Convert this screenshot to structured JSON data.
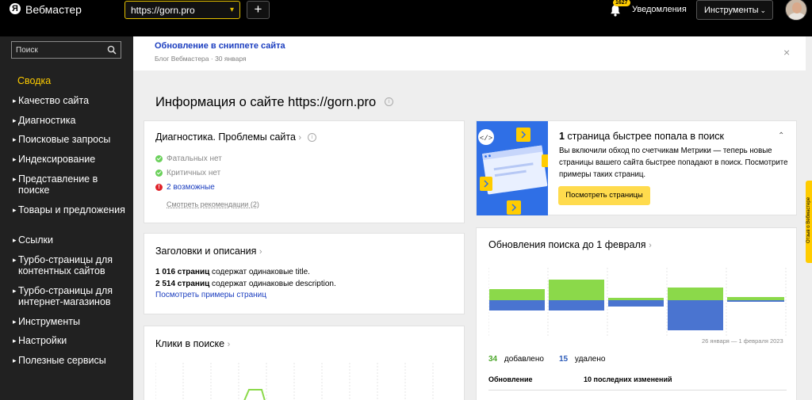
{
  "topbar": {
    "logo_letter": "Я",
    "brand": "Вебмастер",
    "site_selector": "https://gorn.pro",
    "add_site": "+",
    "notifications_count": "1627",
    "notifications_label": "Уведомления",
    "tools_label": "Инструменты"
  },
  "sidebar": {
    "search_placeholder": "Поиск",
    "items": [
      {
        "label": "Сводка",
        "active": true
      },
      {
        "label": "Качество сайта"
      },
      {
        "label": "Диагностика"
      },
      {
        "label": "Поисковые запросы"
      },
      {
        "label": "Индексирование"
      },
      {
        "label": "Представление в поиске"
      },
      {
        "label": "Товары и предложения"
      },
      {
        "label": "Ссылки"
      },
      {
        "label": "Турбо-страницы для контентных сайтов"
      },
      {
        "label": "Турбо-страницы для интернет-магазинов"
      },
      {
        "label": "Инструменты"
      },
      {
        "label": "Настройки"
      },
      {
        "label": "Полезные сервисы"
      }
    ]
  },
  "banner": {
    "title": "Обновление в сниппете сайта",
    "subtitle": "Блог Вебмастера · 30 января",
    "close": "×"
  },
  "page_title": "Информация о сайте https://gorn.pro",
  "diagnostics": {
    "title": "Диагностика. Проблемы сайта",
    "fatal": "Фатальных нет",
    "critical": "Критичных нет",
    "possible": "2 возможные",
    "more_link": "Смотреть рекомендации (2)"
  },
  "titles_card": {
    "title": "Заголовки и описания",
    "line1_count": "1 016 страниц",
    "line1_rest": " содержат одинаковые title.",
    "line2_count": "2 514 страниц",
    "line2_rest": " содержат одинаковые description.",
    "link": "Посмотреть примеры страниц"
  },
  "clicks_card": {
    "title": "Клики в поиске"
  },
  "promo": {
    "title_number": "1",
    "title_rest": " страница быстрее попала в поиск",
    "body": "Вы включили обход по счетчикам Метрики — теперь новые страницы вашего сайта быстрее попадают в поиск. Посмотрите примеры таких страниц.",
    "button": "Посмотреть страницы"
  },
  "updates": {
    "title": "Обновления поиска до 1 февраля",
    "date_range": "26 января — 1 февраля 2023",
    "added_count": "34",
    "added_label": "добавлено",
    "removed_count": "15",
    "removed_label": "удалено",
    "col1": "Обновление",
    "col2": "10 последних изменений",
    "colors": {
      "added": "#8bd94a",
      "removed": "#4a74d0"
    }
  },
  "feedback": "Отзыв о Вебмастере"
}
